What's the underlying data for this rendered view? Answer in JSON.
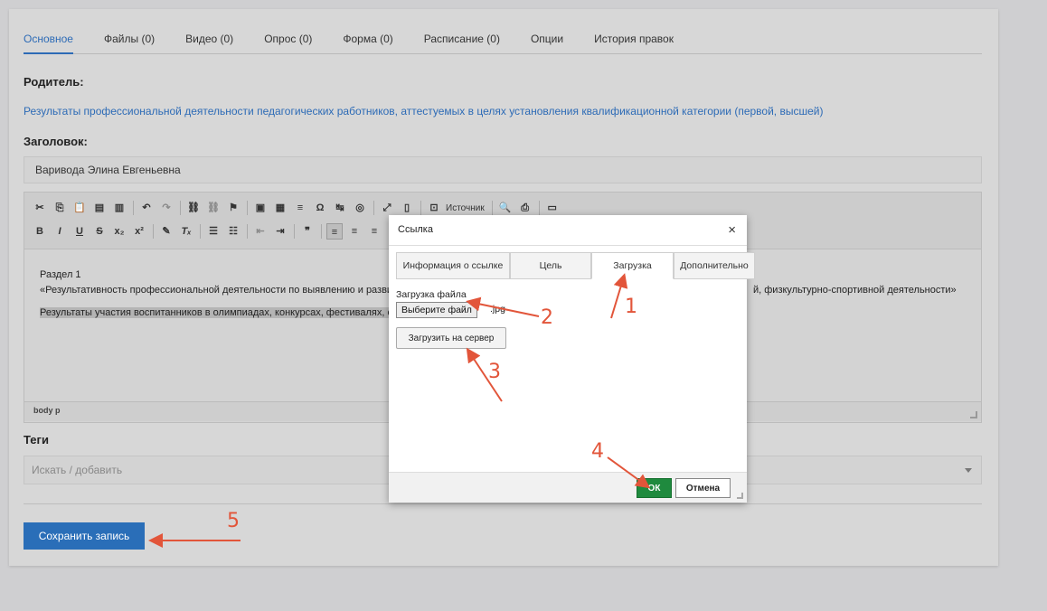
{
  "tabs": [
    "Основное",
    "Файлы (0)",
    "Видео (0)",
    "Опрос (0)",
    "Форма (0)",
    "Расписание (0)",
    "Опции",
    "История правок"
  ],
  "labels": {
    "parent": "Родитель:",
    "title": "Заголовок:",
    "tags": "Теги"
  },
  "parent_link": "Результаты профессиональной деятельности педагогических работников, аттестуемых в целях установления квалификационной категории (первой, высшей)",
  "title_value": "Варивода Элина  Евгеньевна",
  "editor": {
    "source_label": "Источник",
    "line1": "Раздел 1",
    "line2": "«Результативность профессиональной деятельности по выявлению и разви",
    "line2_tail": "й, физкультурно-спортивной деятельности»",
    "line3": "Результаты участия воспитанников в олимпиадах, конкурсах, фестивалях, с",
    "status": "body  p"
  },
  "tags_placeholder": "Искать / добавить",
  "save_label": "Сохранить запись",
  "dialog": {
    "title": "Ссылка",
    "close": "×",
    "tabs": [
      "Информация о ссылке",
      "Цель",
      "Загрузка",
      "Дополнительно"
    ],
    "upload_label": "Загрузка файла",
    "file_button": "Выберите файл",
    "file_name": ".jpg",
    "server_button": "Загрузить на сервер",
    "ok": "ОК",
    "cancel": "Отмена"
  },
  "annotations": [
    "1",
    "2",
    "3",
    "4",
    "5"
  ],
  "colors": {
    "accent": "#2a6eb8",
    "ok": "#1f8a3e",
    "annotation": "#e2553a"
  }
}
